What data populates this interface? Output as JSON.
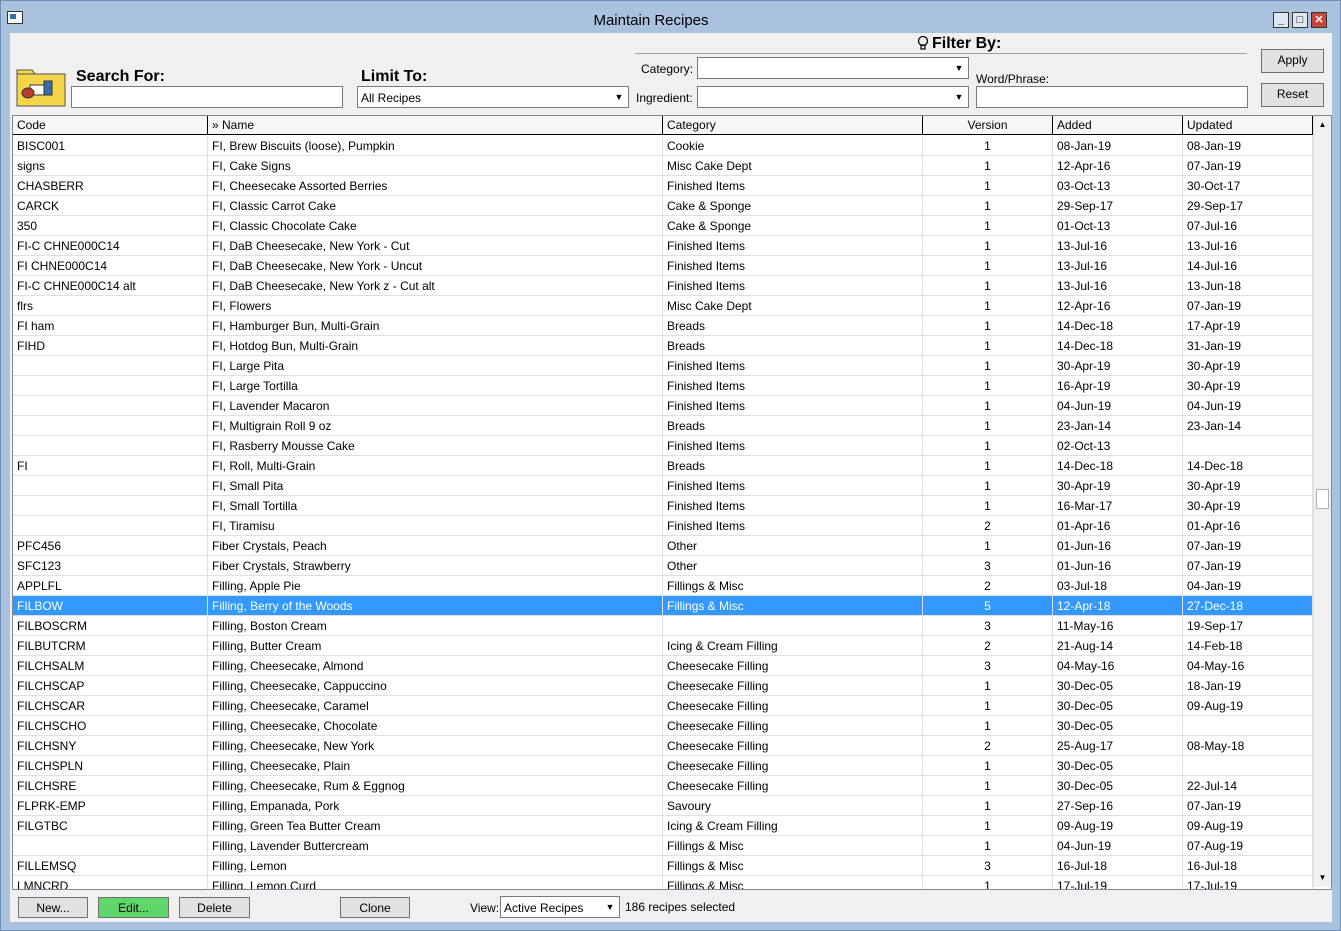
{
  "window": {
    "title": "Maintain Recipes",
    "minimize": "_",
    "maximize": "□",
    "close": "✕"
  },
  "search": {
    "label": "Search For:",
    "value": ""
  },
  "limit": {
    "label": "Limit To:",
    "value": "All Recipes"
  },
  "filter": {
    "title": "Filter By:",
    "category_label": "Category:",
    "category_value": "",
    "ingredient_label": "Ingredient:",
    "ingredient_value": "",
    "word_label": "Word/Phrase:",
    "word_value": ""
  },
  "buttons": {
    "apply": "Apply",
    "reset": "Reset",
    "new": "New...",
    "edit": "Edit...",
    "delete": "Delete",
    "clone": "Clone"
  },
  "view": {
    "label": "View:",
    "value": "Active Recipes",
    "status": "186 recipes selected"
  },
  "columns": [
    "Code",
    "» Name",
    "Category",
    "Version",
    "Added",
    "Updated"
  ],
  "rows": [
    [
      "BISC001",
      "FI, Brew Biscuits (loose), Pumpkin",
      "Cookie",
      "1",
      "08-Jan-19",
      "08-Jan-19"
    ],
    [
      "signs",
      "FI, Cake Signs",
      "Misc Cake Dept",
      "1",
      "12-Apr-16",
      "07-Jan-19"
    ],
    [
      "CHASBERR",
      "FI, Cheesecake Assorted Berries",
      "Finished Items",
      "1",
      "03-Oct-13",
      "30-Oct-17"
    ],
    [
      "CARCK",
      "FI, Classic Carrot Cake",
      "Cake & Sponge",
      "1",
      "29-Sep-17",
      "29-Sep-17"
    ],
    [
      "350",
      "FI, Classic Chocolate Cake",
      "Cake & Sponge",
      "1",
      "01-Oct-13",
      "07-Jul-16"
    ],
    [
      "FI-C CHNE000C14",
      "FI, DaB Cheesecake, New York - Cut",
      "Finished Items",
      "1",
      "13-Jul-16",
      "13-Jul-16"
    ],
    [
      "FI CHNE000C14",
      "FI, DaB Cheesecake, New York - Uncut",
      "Finished Items",
      "1",
      "13-Jul-16",
      "14-Jul-16"
    ],
    [
      "FI-C CHNE000C14 alt",
      "FI, DaB Cheesecake, New York z - Cut alt",
      "Finished Items",
      "1",
      "13-Jul-16",
      "13-Jun-18"
    ],
    [
      "flrs",
      "FI, Flowers",
      "Misc Cake Dept",
      "1",
      "12-Apr-16",
      "07-Jan-19"
    ],
    [
      "FI ham",
      "FI, Hamburger Bun, Multi-Grain",
      "Breads",
      "1",
      "14-Dec-18",
      "17-Apr-19"
    ],
    [
      "FIHD",
      "FI, Hotdog Bun, Multi-Grain",
      "Breads",
      "1",
      "14-Dec-18",
      "31-Jan-19"
    ],
    [
      "",
      "FI, Large Pita",
      "Finished Items",
      "1",
      "30-Apr-19",
      "30-Apr-19"
    ],
    [
      "",
      "FI, Large Tortilla",
      "Finished Items",
      "1",
      "16-Apr-19",
      "30-Apr-19"
    ],
    [
      "",
      "FI, Lavender Macaron",
      "Finished Items",
      "1",
      "04-Jun-19",
      "04-Jun-19"
    ],
    [
      "",
      "FI, Multigrain Roll 9 oz",
      "Breads",
      "1",
      "23-Jan-14",
      "23-Jan-14"
    ],
    [
      "",
      "FI, Rasberry Mousse Cake",
      "Finished Items",
      "1",
      "02-Oct-13",
      ""
    ],
    [
      "FI",
      "FI, Roll, Multi-Grain",
      "Breads",
      "1",
      "14-Dec-18",
      "14-Dec-18"
    ],
    [
      "",
      "FI, Small Pita",
      "Finished Items",
      "1",
      "30-Apr-19",
      "30-Apr-19"
    ],
    [
      "",
      "FI, Small Tortilla",
      "Finished Items",
      "1",
      "16-Mar-17",
      "30-Apr-19"
    ],
    [
      "",
      "FI, Tiramisu",
      "Finished Items",
      "2",
      "01-Apr-16",
      "01-Apr-16"
    ],
    [
      "PFC456",
      "Fiber Crystals, Peach",
      "Other",
      "1",
      "01-Jun-16",
      "07-Jan-19"
    ],
    [
      "SFC123",
      "Fiber Crystals, Strawberry",
      "Other",
      "3",
      "01-Jun-16",
      "07-Jan-19"
    ],
    [
      "APPLFL",
      "Filling, Apple Pie",
      "Fillings & Misc",
      "2",
      "03-Jul-18",
      "04-Jan-19"
    ],
    [
      "FILBOW",
      "Filling, Berry of the Woods",
      "Fillings & Misc",
      "5",
      "12-Apr-18",
      "27-Dec-18"
    ],
    [
      "FILBOSCRM",
      "Filling, Boston Cream",
      "",
      "3",
      "11-May-16",
      "19-Sep-17"
    ],
    [
      "FILBUTCRM",
      "Filling, Butter Cream",
      "Icing & Cream Filling",
      "2",
      "21-Aug-14",
      "14-Feb-18"
    ],
    [
      "FILCHSALM",
      "Filling, Cheesecake, Almond",
      "Cheesecake Filling",
      "3",
      "04-May-16",
      "04-May-16"
    ],
    [
      "FILCHSCAP",
      "Filling, Cheesecake, Cappuccino",
      "Cheesecake Filling",
      "1",
      "30-Dec-05",
      "18-Jan-19"
    ],
    [
      "FILCHSCAR",
      "Filling, Cheesecake, Caramel",
      "Cheesecake Filling",
      "1",
      "30-Dec-05",
      "09-Aug-19"
    ],
    [
      "FILCHSCHO",
      "Filling, Cheesecake, Chocolate",
      "Cheesecake Filling",
      "1",
      "30-Dec-05",
      ""
    ],
    [
      "FILCHSNY",
      "Filling, Cheesecake, New York",
      "Cheesecake Filling",
      "2",
      "25-Aug-17",
      "08-May-18"
    ],
    [
      "FILCHSPLN",
      "Filling, Cheesecake, Plain",
      "Cheesecake Filling",
      "1",
      "30-Dec-05",
      ""
    ],
    [
      "FILCHSRE",
      "Filling, Cheesecake, Rum & Eggnog",
      "Cheesecake Filling",
      "1",
      "30-Dec-05",
      "22-Jul-14"
    ],
    [
      "FLPRK-EMP",
      "Filling, Empanada, Pork",
      "Savoury",
      "1",
      "27-Sep-16",
      "07-Jan-19"
    ],
    [
      "FILGTBC",
      "Filling, Green Tea Butter Cream",
      "Icing & Cream Filling",
      "1",
      "09-Aug-19",
      "09-Aug-19"
    ],
    [
      "",
      "Filling, Lavender Buttercream",
      "Fillings & Misc",
      "1",
      "04-Jun-19",
      "07-Aug-19"
    ],
    [
      "FILLEMSQ",
      "Filling, Lemon",
      "Fillings & Misc",
      "3",
      "16-Jul-18",
      "16-Jul-18"
    ],
    [
      "LMNCRD",
      "Filling, Lemon Curd",
      "Fillings & Misc",
      "1",
      "17-Jul-19",
      "17-Jul-19"
    ]
  ],
  "selected_row": 23
}
